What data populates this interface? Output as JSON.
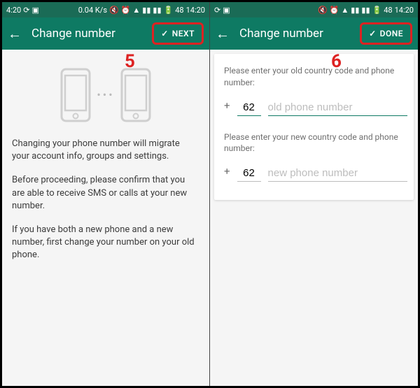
{
  "statusbar": {
    "time_left": "4:20",
    "net": "0.04 K/s",
    "battery": "48",
    "time_right": "14:20"
  },
  "left": {
    "title": "Change number",
    "action": "NEXT",
    "step_annotation": "5",
    "para1": "Changing your phone number will migrate your account info, groups and settings.",
    "para2": "Before proceeding, please confirm that you are able to receive SMS or calls at your new number.",
    "para3": "If you have both a new phone and a new number, first change your number on your old phone."
  },
  "right": {
    "title": "Change number",
    "action": "DONE",
    "step_annotation": "6",
    "old_label": "Please enter your old country code and phone number:",
    "old_cc": "62",
    "old_placeholder": "old phone number",
    "new_label": "Please enter your new country code and phone number:",
    "new_cc": "62",
    "new_placeholder": "new phone number"
  }
}
